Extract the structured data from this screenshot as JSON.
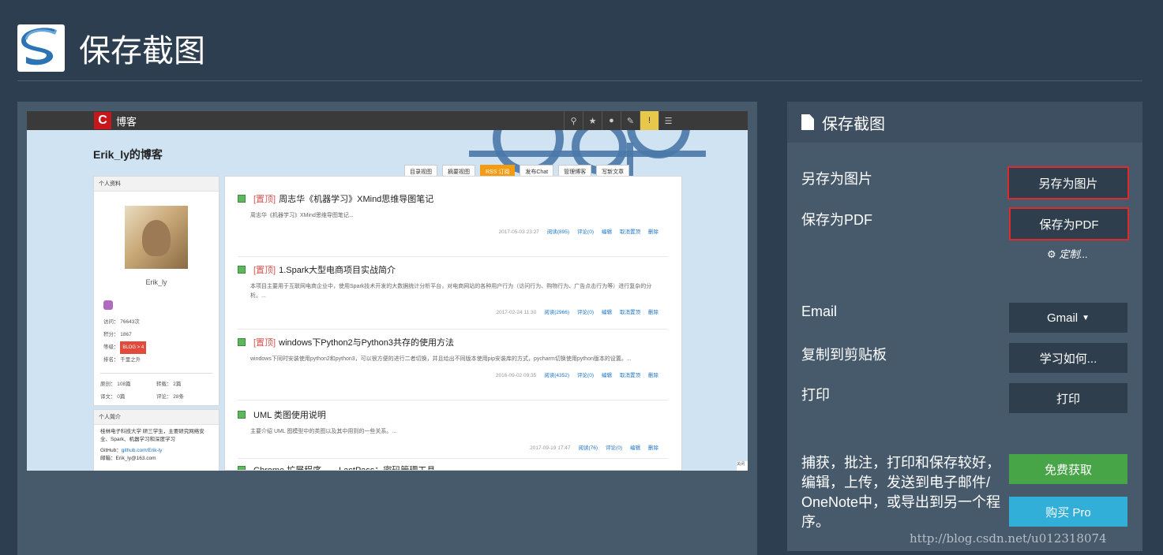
{
  "app": {
    "title": "保存截图"
  },
  "blog_screenshot": {
    "brand_initial": "C",
    "brand_name": "博客",
    "blog_title": "Erik_ly的博客",
    "nav_icons": [
      "search-icon",
      "star-icon",
      "bell-icon",
      "edit-icon",
      "info-icon",
      "menu-icon"
    ],
    "tabs": [
      "目录视图",
      "摘要视图",
      "RSS 订阅",
      "发布Chat",
      "管理博客",
      "写新文章"
    ],
    "profile": {
      "header": "个人资料",
      "username": "Erik_ly",
      "visits": "访问： 76643次",
      "points": "积分： 1867",
      "level_label": "等级：",
      "level_badge": "BLOG > 4",
      "rank": "排名： 千里之外",
      "original": "原创： 108篇",
      "reprint": "转载： 2篇",
      "translated": "译文： 0篇",
      "comments": "评论： 28条"
    },
    "intro": {
      "header": "个人简介",
      "text": "桂林电子科技大学 研三学生，主要研究网络安全、Spark、机器学习和深度学习",
      "github_label": "GitHub：",
      "github_link": "github.com/Erik-ly",
      "email": "邮箱：Erik_ly@163.com"
    },
    "posts": [
      {
        "pinned": "[置顶]",
        "title": "周志华《机器学习》XMind思维导图笔记",
        "excerpt": "周志华《机器学习》XMind思维导图笔记...",
        "date": "2017-05-03 23:27",
        "reads": "阅读(895)",
        "comments": "评论(0)",
        "edit": "编辑",
        "unpin": "取消置顶",
        "delete": "删除"
      },
      {
        "pinned": "[置顶]",
        "title": "1.Spark大型电商项目实战简介",
        "excerpt": "本项目主要用于互联网电商企业中，使用Spark技术开发的大数据统计分析平台，对电商网站的各种用户行为（访问行为、购物行为、广告点击行为等）进行复杂的分析。...",
        "date": "2017-02-24 11:30",
        "reads": "阅读(2966)",
        "comments": "评论(0)",
        "edit": "编辑",
        "unpin": "取消置顶",
        "delete": "删除"
      },
      {
        "pinned": "[置顶]",
        "title": "windows下Python2与Python3共存的使用方法",
        "excerpt": "windows下同时安装使用python2和python3，可以很方便的进行二者切换，并且给出不同版本使用pip安装库的方式，pycharm切换使用python版本的设置。...",
        "date": "2016-09-02 09:35",
        "reads": "阅读(4352)",
        "comments": "评论(0)",
        "edit": "编辑",
        "unpin": "取消置顶",
        "delete": "删除"
      },
      {
        "pinned": "",
        "title": "UML 类图使用说明",
        "excerpt": "主要介绍 UML 图模型中的类图以及其中用到的一些关系。...",
        "date": "2017-09-19 17:47",
        "reads": "阅读(76)",
        "comments": "评论(0)",
        "edit": "编辑",
        "unpin": "",
        "delete": "删除"
      },
      {
        "pinned": "",
        "title": "Chrome 扩展程序——LastPass：密码管理工具",
        "excerpt": "",
        "date": "",
        "reads": "",
        "comments": "",
        "edit": "",
        "unpin": "",
        "delete": ""
      }
    ],
    "corner_text": "关闭"
  },
  "options": {
    "header": "保存截图",
    "save_image_label": "另存为图片",
    "save_image_button": "另存为图片",
    "save_pdf_label": "保存为PDF",
    "save_pdf_button": "保存为PDF",
    "customize": "定制...",
    "email_label": "Email",
    "email_button": "Gmail",
    "clipboard_label": "复制到剪贴板",
    "clipboard_button": "学习如何...",
    "print_label": "打印",
    "print_button": "打印",
    "promo_text": "捕获，批注，打印和保存较好，编辑，上传，发送到电子邮件/ OneNote中，或导出到另一个程序。",
    "free_button": "免费获取",
    "buy_button": "购买 Pro"
  },
  "watermark": "http://blog.csdn.net/u012318074",
  "colors": {
    "background": "#2c3e50",
    "panel": "#475a6c",
    "button": "#2f3e4d",
    "green": "#47a547",
    "blue": "#31afd9",
    "highlight_outline": "#e02a2a"
  }
}
